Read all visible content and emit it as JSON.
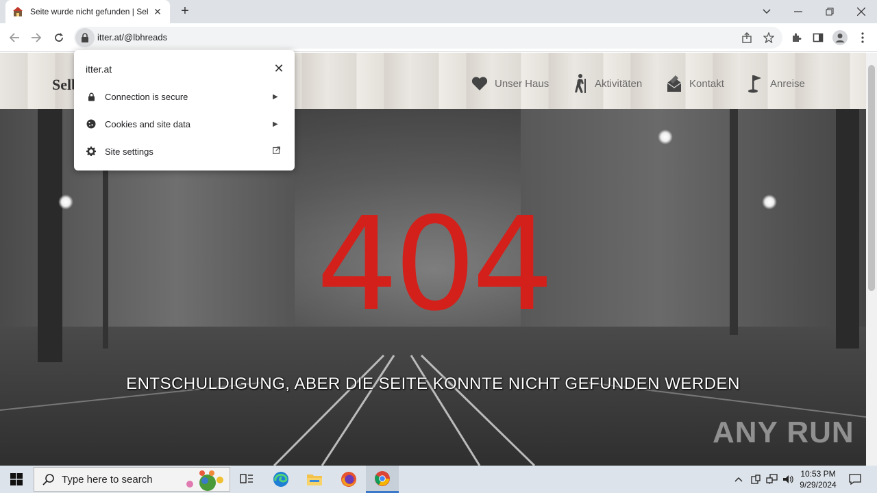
{
  "browser": {
    "tab": {
      "title": "Seite wurde nicht gefunden | Sel",
      "close": "✕"
    },
    "new_tab": "+",
    "url": "itter.at/@lbhreads"
  },
  "site_info_popup": {
    "host": "itter.at",
    "close": "✕",
    "rows": [
      {
        "label": "Connection is secure",
        "icon": "lock-icon",
        "trail": "▶"
      },
      {
        "label": "Cookies and site data",
        "icon": "cookie-icon",
        "trail": "▶"
      },
      {
        "label": "Site settings",
        "icon": "gear-icon",
        "trail": "external-link-icon"
      }
    ]
  },
  "site": {
    "brand": "Selb",
    "nav": [
      {
        "label": "Unser Haus",
        "icon": "heart-icon"
      },
      {
        "label": "Aktivitäten",
        "icon": "hiker-icon"
      },
      {
        "label": "Kontakt",
        "icon": "mail-icon"
      },
      {
        "label": "Anreise",
        "icon": "flag-icon"
      }
    ],
    "error_code": "404",
    "error_message": "ENTSCHULDIGUNG, ABER DIE SEITE KONNTE NICHT GEFUNDEN WERDEN",
    "watermark": "ANY RUN"
  },
  "taskbar": {
    "search_placeholder": "Type here to search",
    "time": "10:53 PM",
    "date": "9/29/2024"
  },
  "colors": {
    "error_red": "#d4201a",
    "tab_strip": "#dee1e6",
    "taskbar": "#dde3ea"
  }
}
